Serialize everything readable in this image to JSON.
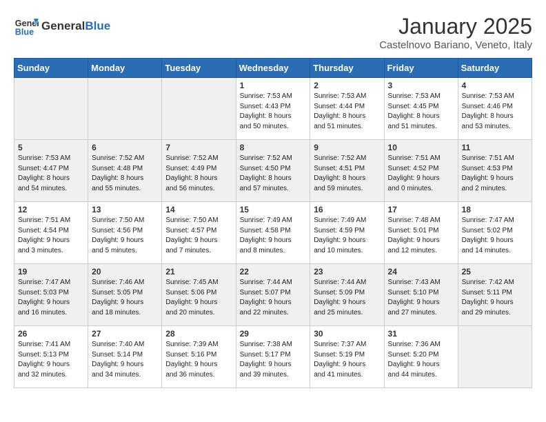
{
  "header": {
    "logo_general": "General",
    "logo_blue": "Blue",
    "month": "January 2025",
    "location": "Castelnovo Bariano, Veneto, Italy"
  },
  "days_of_week": [
    "Sunday",
    "Monday",
    "Tuesday",
    "Wednesday",
    "Thursday",
    "Friday",
    "Saturday"
  ],
  "weeks": [
    [
      {
        "day": "",
        "info": ""
      },
      {
        "day": "",
        "info": ""
      },
      {
        "day": "",
        "info": ""
      },
      {
        "day": "1",
        "info": "Sunrise: 7:53 AM\nSunset: 4:43 PM\nDaylight: 8 hours\nand 50 minutes."
      },
      {
        "day": "2",
        "info": "Sunrise: 7:53 AM\nSunset: 4:44 PM\nDaylight: 8 hours\nand 51 minutes."
      },
      {
        "day": "3",
        "info": "Sunrise: 7:53 AM\nSunset: 4:45 PM\nDaylight: 8 hours\nand 51 minutes."
      },
      {
        "day": "4",
        "info": "Sunrise: 7:53 AM\nSunset: 4:46 PM\nDaylight: 8 hours\nand 53 minutes."
      }
    ],
    [
      {
        "day": "5",
        "info": "Sunrise: 7:53 AM\nSunset: 4:47 PM\nDaylight: 8 hours\nand 54 minutes."
      },
      {
        "day": "6",
        "info": "Sunrise: 7:52 AM\nSunset: 4:48 PM\nDaylight: 8 hours\nand 55 minutes."
      },
      {
        "day": "7",
        "info": "Sunrise: 7:52 AM\nSunset: 4:49 PM\nDaylight: 8 hours\nand 56 minutes."
      },
      {
        "day": "8",
        "info": "Sunrise: 7:52 AM\nSunset: 4:50 PM\nDaylight: 8 hours\nand 57 minutes."
      },
      {
        "day": "9",
        "info": "Sunrise: 7:52 AM\nSunset: 4:51 PM\nDaylight: 8 hours\nand 59 minutes."
      },
      {
        "day": "10",
        "info": "Sunrise: 7:51 AM\nSunset: 4:52 PM\nDaylight: 9 hours\nand 0 minutes."
      },
      {
        "day": "11",
        "info": "Sunrise: 7:51 AM\nSunset: 4:53 PM\nDaylight: 9 hours\nand 2 minutes."
      }
    ],
    [
      {
        "day": "12",
        "info": "Sunrise: 7:51 AM\nSunset: 4:54 PM\nDaylight: 9 hours\nand 3 minutes."
      },
      {
        "day": "13",
        "info": "Sunrise: 7:50 AM\nSunset: 4:56 PM\nDaylight: 9 hours\nand 5 minutes."
      },
      {
        "day": "14",
        "info": "Sunrise: 7:50 AM\nSunset: 4:57 PM\nDaylight: 9 hours\nand 7 minutes."
      },
      {
        "day": "15",
        "info": "Sunrise: 7:49 AM\nSunset: 4:58 PM\nDaylight: 9 hours\nand 8 minutes."
      },
      {
        "day": "16",
        "info": "Sunrise: 7:49 AM\nSunset: 4:59 PM\nDaylight: 9 hours\nand 10 minutes."
      },
      {
        "day": "17",
        "info": "Sunrise: 7:48 AM\nSunset: 5:01 PM\nDaylight: 9 hours\nand 12 minutes."
      },
      {
        "day": "18",
        "info": "Sunrise: 7:47 AM\nSunset: 5:02 PM\nDaylight: 9 hours\nand 14 minutes."
      }
    ],
    [
      {
        "day": "19",
        "info": "Sunrise: 7:47 AM\nSunset: 5:03 PM\nDaylight: 9 hours\nand 16 minutes."
      },
      {
        "day": "20",
        "info": "Sunrise: 7:46 AM\nSunset: 5:05 PM\nDaylight: 9 hours\nand 18 minutes."
      },
      {
        "day": "21",
        "info": "Sunrise: 7:45 AM\nSunset: 5:06 PM\nDaylight: 9 hours\nand 20 minutes."
      },
      {
        "day": "22",
        "info": "Sunrise: 7:44 AM\nSunset: 5:07 PM\nDaylight: 9 hours\nand 22 minutes."
      },
      {
        "day": "23",
        "info": "Sunrise: 7:44 AM\nSunset: 5:09 PM\nDaylight: 9 hours\nand 25 minutes."
      },
      {
        "day": "24",
        "info": "Sunrise: 7:43 AM\nSunset: 5:10 PM\nDaylight: 9 hours\nand 27 minutes."
      },
      {
        "day": "25",
        "info": "Sunrise: 7:42 AM\nSunset: 5:11 PM\nDaylight: 9 hours\nand 29 minutes."
      }
    ],
    [
      {
        "day": "26",
        "info": "Sunrise: 7:41 AM\nSunset: 5:13 PM\nDaylight: 9 hours\nand 32 minutes."
      },
      {
        "day": "27",
        "info": "Sunrise: 7:40 AM\nSunset: 5:14 PM\nDaylight: 9 hours\nand 34 minutes."
      },
      {
        "day": "28",
        "info": "Sunrise: 7:39 AM\nSunset: 5:16 PM\nDaylight: 9 hours\nand 36 minutes."
      },
      {
        "day": "29",
        "info": "Sunrise: 7:38 AM\nSunset: 5:17 PM\nDaylight: 9 hours\nand 39 minutes."
      },
      {
        "day": "30",
        "info": "Sunrise: 7:37 AM\nSunset: 5:19 PM\nDaylight: 9 hours\nand 41 minutes."
      },
      {
        "day": "31",
        "info": "Sunrise: 7:36 AM\nSunset: 5:20 PM\nDaylight: 9 hours\nand 44 minutes."
      },
      {
        "day": "",
        "info": ""
      }
    ]
  ]
}
